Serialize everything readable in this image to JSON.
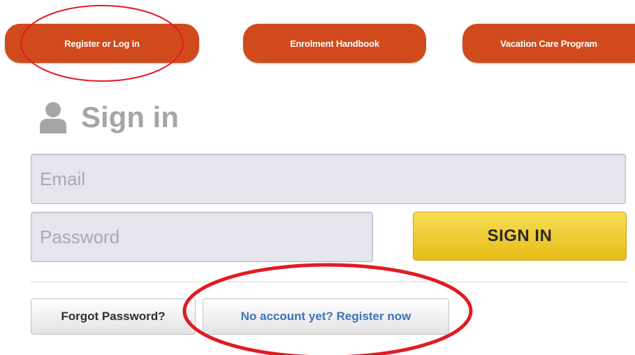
{
  "nav": {
    "items": [
      {
        "label": "Register or Log in"
      },
      {
        "label": "Enrolment Handbook"
      },
      {
        "label": "Vacation Care Program"
      }
    ],
    "color": "#d14a1c"
  },
  "signin": {
    "icon": "user-icon",
    "heading": "Sign in",
    "email_placeholder": "Email",
    "password_placeholder": "Password",
    "submit_label": "SIGN IN",
    "submit_color": "#f2cf2f"
  },
  "footer": {
    "forgot_label": "Forgot Password?",
    "register_label": "No account yet? Register now",
    "link_color": "#3a73b9"
  },
  "annotations": {
    "color": "#e11b22"
  }
}
